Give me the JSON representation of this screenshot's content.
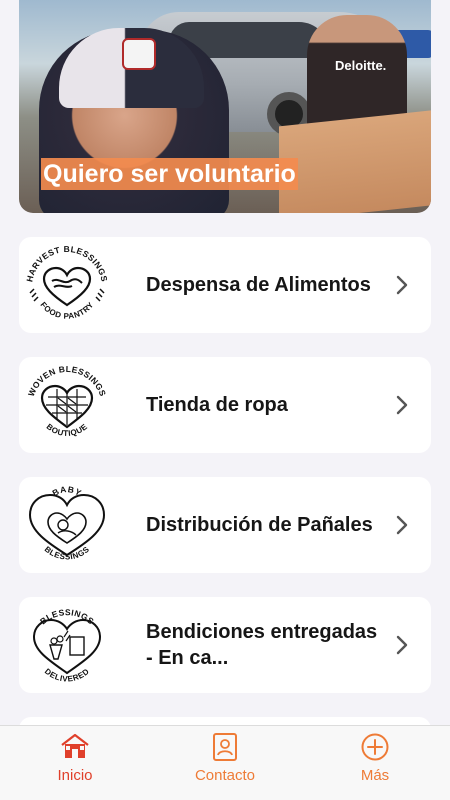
{
  "hero": {
    "caption": "Quiero ser voluntario",
    "shirt_brand": "Deloitte."
  },
  "cards": [
    {
      "title": "Despensa de Alimentos",
      "logo_icon": "harvest-blessings-food-pantry-logo",
      "logo_top_text": "HARVEST BLESSINGS",
      "logo_bottom_text": "FOOD PANTRY"
    },
    {
      "title": "Tienda de ropa",
      "logo_icon": "woven-blessings-boutique-logo",
      "logo_top_text": "WOVEN BLESSINGS",
      "logo_bottom_text": "BOUTIQUE"
    },
    {
      "title": "Distribución de Pañales",
      "logo_icon": "baby-blessings-logo",
      "logo_top_text": "BABY",
      "logo_bottom_text": "BLESSINGS"
    },
    {
      "title": "Bendiciones entregadas - En ca...",
      "logo_icon": "blessings-delivered-logo",
      "logo_top_text": "BLESSINGS",
      "logo_bottom_text": "DELIVERED"
    }
  ],
  "tabbar": {
    "items": [
      {
        "label": "Inicio",
        "icon": "home-icon",
        "active": true
      },
      {
        "label": "Contacto",
        "icon": "contact-book-icon",
        "active": false
      },
      {
        "label": "Más",
        "icon": "plus-circle-icon",
        "active": false
      }
    ]
  },
  "colors": {
    "accent": "#ee7b36",
    "active_tab": "#e0402b",
    "background": "#f4f3f8",
    "card": "#ffffff"
  }
}
